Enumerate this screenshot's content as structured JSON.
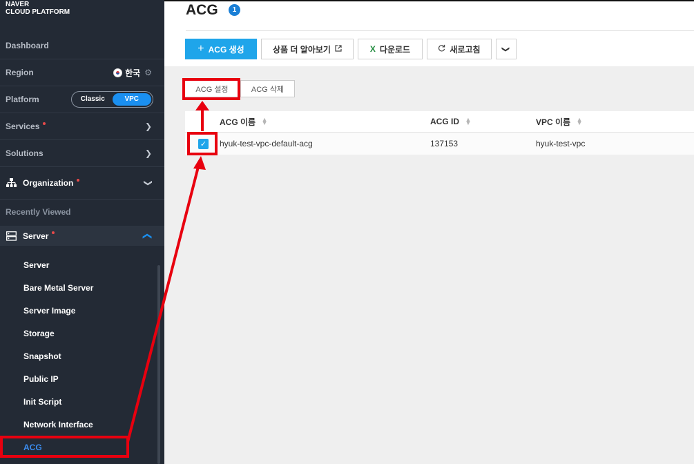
{
  "brand": {
    "line1": "NAVER",
    "line2": "CLOUD PLATFORM"
  },
  "sidebar": {
    "dashboard": "Dashboard",
    "region": {
      "label": "Region",
      "value": "한국"
    },
    "platform": {
      "label": "Platform",
      "options": [
        "Classic",
        "VPC"
      ],
      "selected": "VPC"
    },
    "services": "Services",
    "solutions": "Solutions",
    "organization": "Organization",
    "recently_viewed": "Recently Viewed",
    "server_group": "Server",
    "server_items": [
      "Server",
      "Bare Metal Server",
      "Server Image",
      "Storage",
      "Snapshot",
      "Public IP",
      "Init Script",
      "Network Interface",
      "ACG"
    ],
    "active_item": "ACG"
  },
  "header": {
    "title": "ACG",
    "count": "1"
  },
  "toolbar": {
    "create": "ACG 생성",
    "learn_more": "상품 더 알아보기",
    "download": "다운로드",
    "refresh": "새로고침"
  },
  "actions": {
    "settings": "ACG 설정",
    "delete": "ACG 삭제"
  },
  "table": {
    "columns": [
      "ACG 이름",
      "ACG ID",
      "VPC 이름"
    ],
    "rows": [
      {
        "checked": true,
        "name": "hyuk-test-vpc-default-acg",
        "id": "137153",
        "vpc": "hyuk-test-vpc"
      }
    ]
  },
  "colors": {
    "accent": "#1fa5ea",
    "annotation": "#e8000f",
    "sidebar": "#232a35"
  }
}
